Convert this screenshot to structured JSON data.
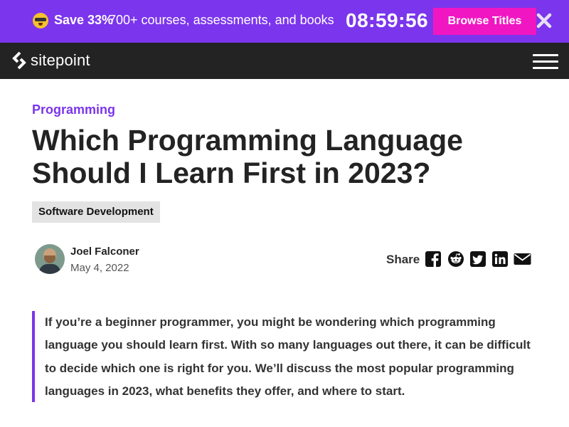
{
  "promo": {
    "save": "Save 33%",
    "offer": "700+ courses, assessments, and books",
    "timer": "08:59:56",
    "button_label": "Browse Titles",
    "icon_emoji": "mind-blown-emoji-icon",
    "icon_close": "close-icon",
    "background_color": "#7b35ec",
    "button_color": "#f017c3"
  },
  "nav": {
    "logo_text": "sitepoint",
    "logo_icon": "sitepoint-logo-icon",
    "menu_icon": "hamburger-menu-icon",
    "background_color": "#232323"
  },
  "article": {
    "category": "Programming",
    "title": "Which Programming Language Should I Learn First in 2023?",
    "tag": "Software Development",
    "author": "Joel Falconer",
    "date": "May 4, 2022",
    "share_label": "Share",
    "share_icons": [
      "facebook-icon",
      "reddit-icon",
      "twitter-icon",
      "linkedin-icon",
      "email-icon"
    ],
    "lead": "If you’re a beginner programmer, you might be wondering which programming language you should learn first. With so many languages out there, it can be difficult to decide which one is right for you. We’ll discuss the most popular programming languages in 2023, what benefits they offer, and where to start.",
    "accent_color": "#7b35ec"
  }
}
